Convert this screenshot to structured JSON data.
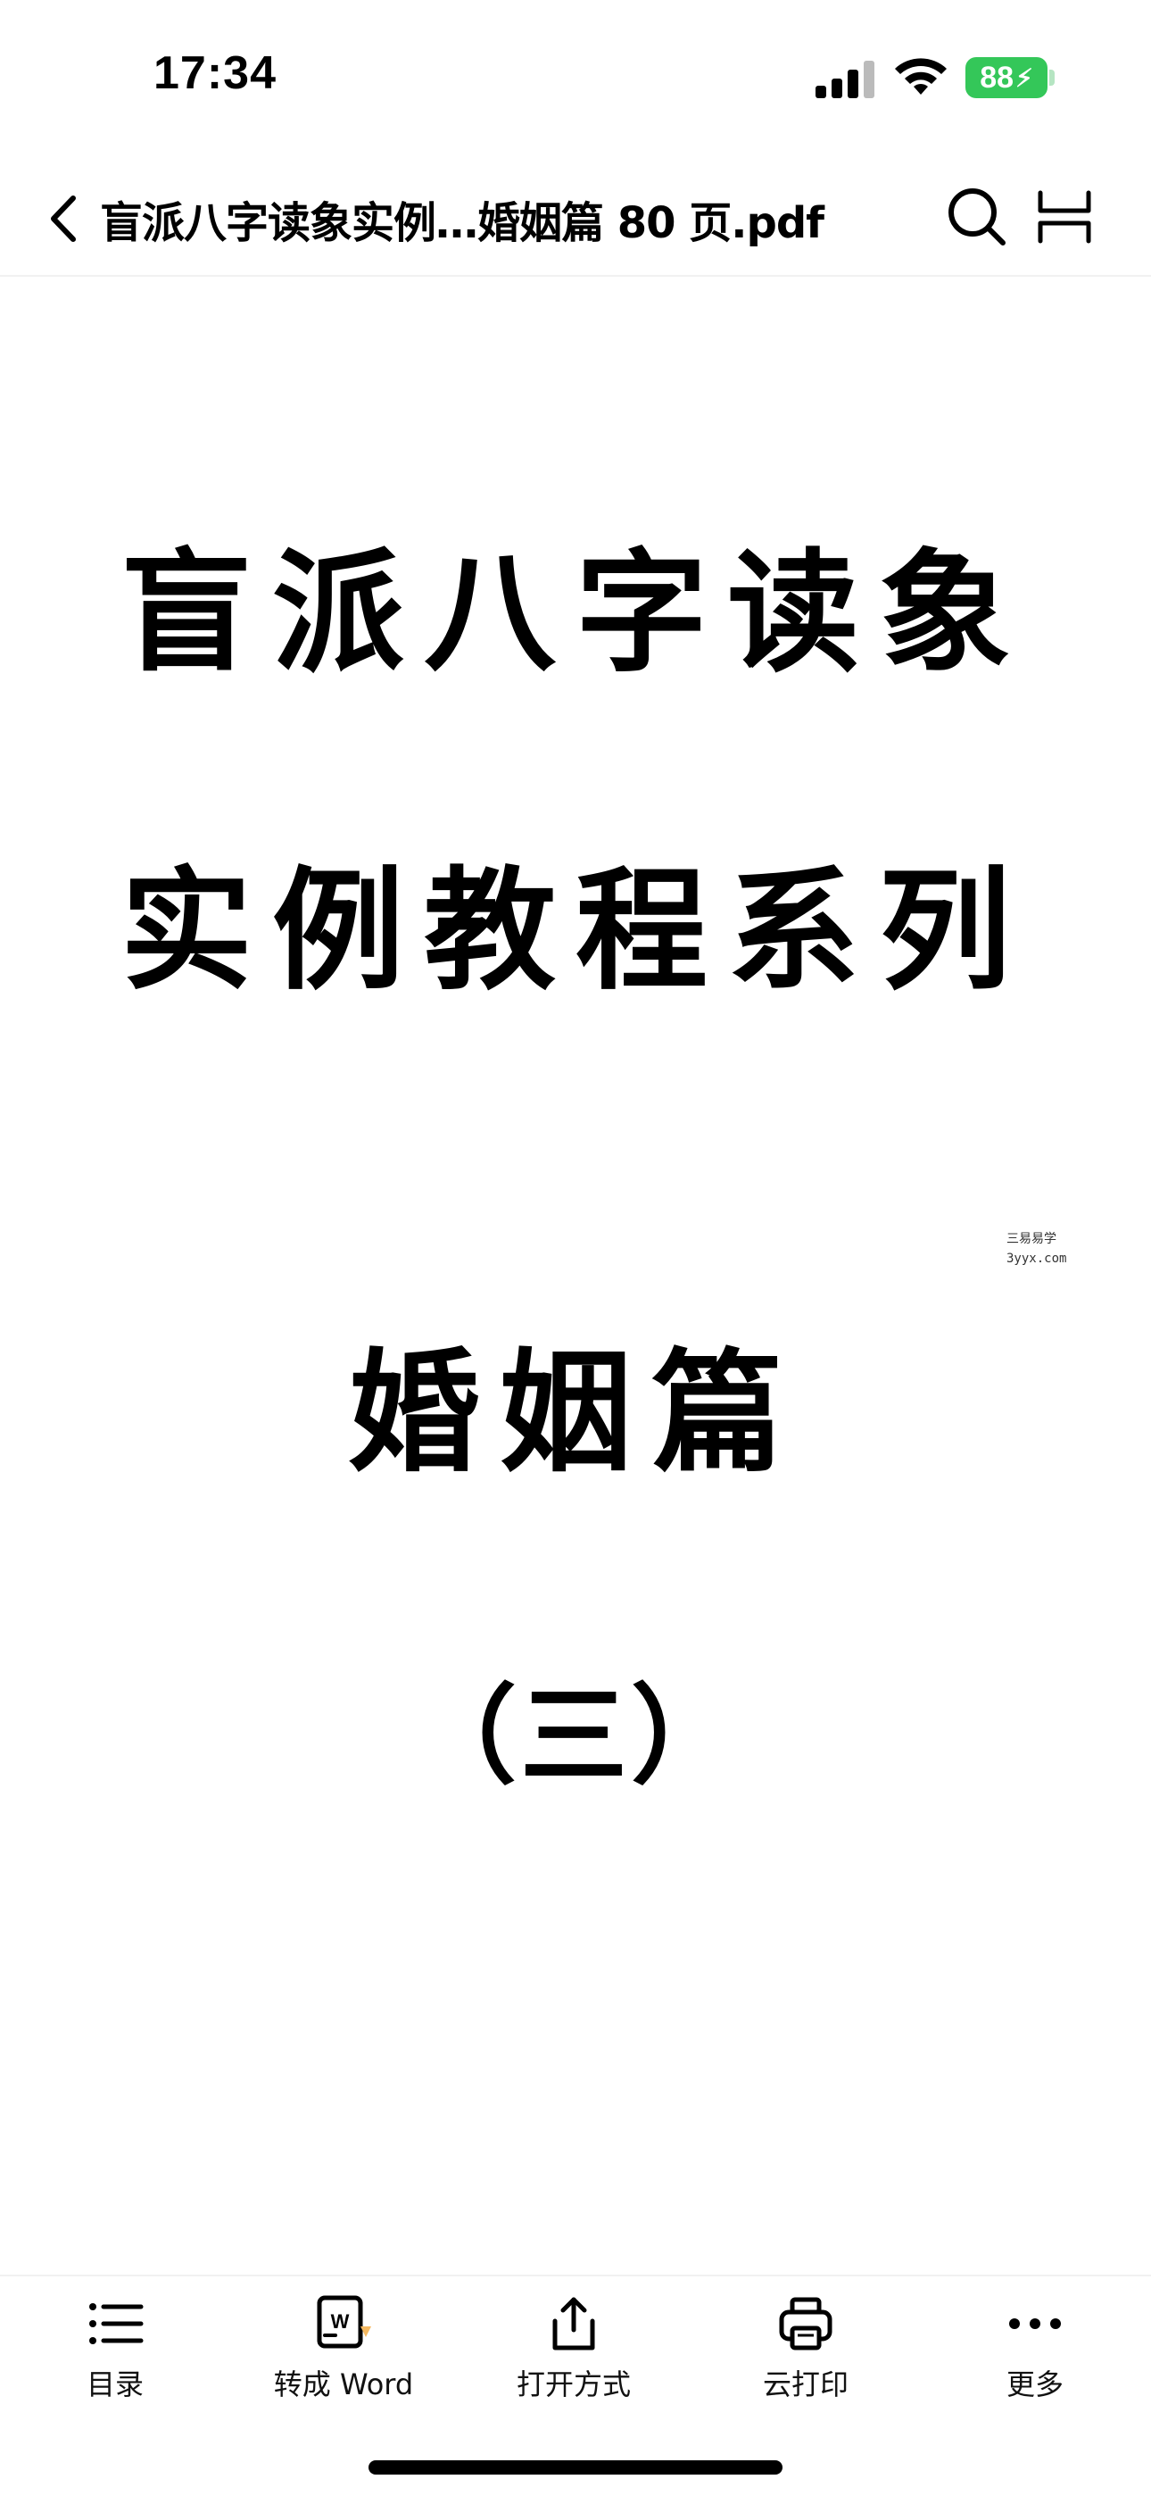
{
  "status_bar": {
    "time": "17:34",
    "battery_level": "88",
    "icons": [
      "signal-icon",
      "wifi-icon",
      "battery-charging-icon"
    ]
  },
  "nav": {
    "title": "盲派八字读象实例…婚姻篇 80 页.pdf",
    "icons": [
      "back-chevron-icon",
      "search-icon",
      "layout-icon"
    ]
  },
  "document": {
    "title_line_1": "盲派八字读象",
    "title_line_2": "实例教程系列",
    "title_line_3": "婚姻篇",
    "title_line_4": "（三）",
    "watermark_line_1": "三易易学",
    "watermark_line_2": "3yyx.com"
  },
  "toolbar": {
    "items": [
      {
        "label": "目录",
        "icon": "list-icon"
      },
      {
        "label": "转成 Word",
        "icon": "word-convert-icon"
      },
      {
        "label": "打开方式",
        "icon": "share-icon"
      },
      {
        "label": "云打印",
        "icon": "printer-icon"
      },
      {
        "label": "更多",
        "icon": "more-dots-icon"
      }
    ]
  },
  "colors": {
    "battery": "#34c759",
    "text": "#000000",
    "background": "#ffffff"
  }
}
